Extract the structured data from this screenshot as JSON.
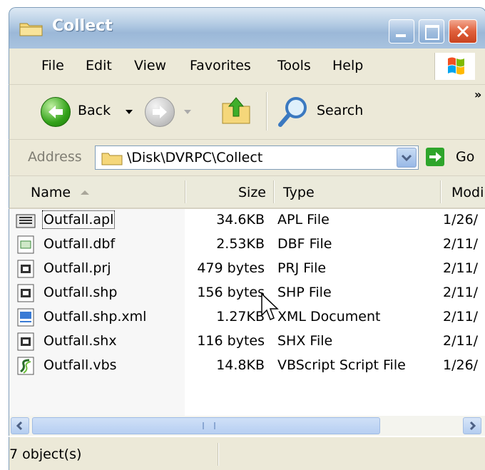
{
  "window": {
    "title": "Collect",
    "title_icon": "folder-icon",
    "buttons": [
      "minimize",
      "maximize",
      "close"
    ]
  },
  "menu": {
    "items": [
      "File",
      "Edit",
      "View",
      "Favorites",
      "Tools",
      "Help"
    ]
  },
  "toolbar": {
    "back_label": "Back",
    "search_label": "Search",
    "overflow": "»"
  },
  "address": {
    "label": "Address",
    "value": "\\Disk\\DVRPC\\Collect",
    "go_label": "Go"
  },
  "columns": {
    "name": "Name",
    "size": "Size",
    "type": "Type",
    "modified": "Modi"
  },
  "files": [
    {
      "name": "Outfall.apl",
      "size": "34.6KB",
      "type": "APL File",
      "date": "1/26/",
      "icon": "apl-file-icon"
    },
    {
      "name": "Outfall.dbf",
      "size": "2.53KB",
      "type": "DBF File",
      "date": "2/11/",
      "icon": "dbf-file-icon"
    },
    {
      "name": "Outfall.prj",
      "size": "479 bytes",
      "type": "PRJ File",
      "date": "2/11/",
      "icon": "generic-file-icon"
    },
    {
      "name": "Outfall.shp",
      "size": "156 bytes",
      "type": "SHP File",
      "date": "2/11/",
      "icon": "generic-file-icon"
    },
    {
      "name": "Outfall.shp.xml",
      "size": "1.27KB",
      "type": "XML Document",
      "date": "2/11/",
      "icon": "xml-file-icon"
    },
    {
      "name": "Outfall.shx",
      "size": "116 bytes",
      "type": "SHX File",
      "date": "2/11/",
      "icon": "generic-file-icon"
    },
    {
      "name": "Outfall.vbs",
      "size": "14.8KB",
      "type": "VBScript Script File",
      "date": "1/26/",
      "icon": "script-file-icon"
    }
  ],
  "status": {
    "text": "7 object(s)"
  },
  "colors": {
    "menu_bg": "#ece9d8",
    "close_button": "#e0603c",
    "back_green": "#33a21a"
  }
}
